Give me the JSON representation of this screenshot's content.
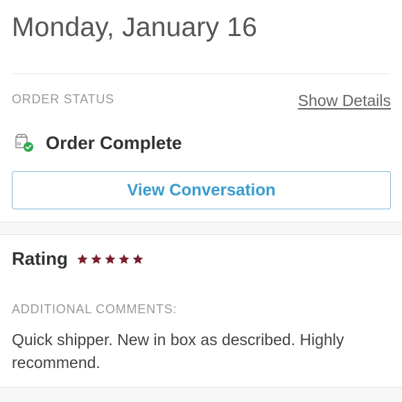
{
  "header": {
    "date": "Monday, January 16"
  },
  "order": {
    "status_label": "ORDER STATUS",
    "show_details_label": "Show Details",
    "status_icon": "package-check-icon",
    "status_text": "Order Complete",
    "view_conversation_label": "View Conversation"
  },
  "rating": {
    "label": "Rating",
    "stars": 5,
    "max_stars": 5,
    "star_icon": "star-icon",
    "star_color": "#7a1f2e"
  },
  "comments": {
    "label": "ADDITIONAL COMMENTS:",
    "text": "Quick shipper. New in box as described. Highly recommend."
  },
  "colors": {
    "accent_blue": "#3a9ccd",
    "check_green": "#2fa84f",
    "star": "#7a1f2e"
  }
}
